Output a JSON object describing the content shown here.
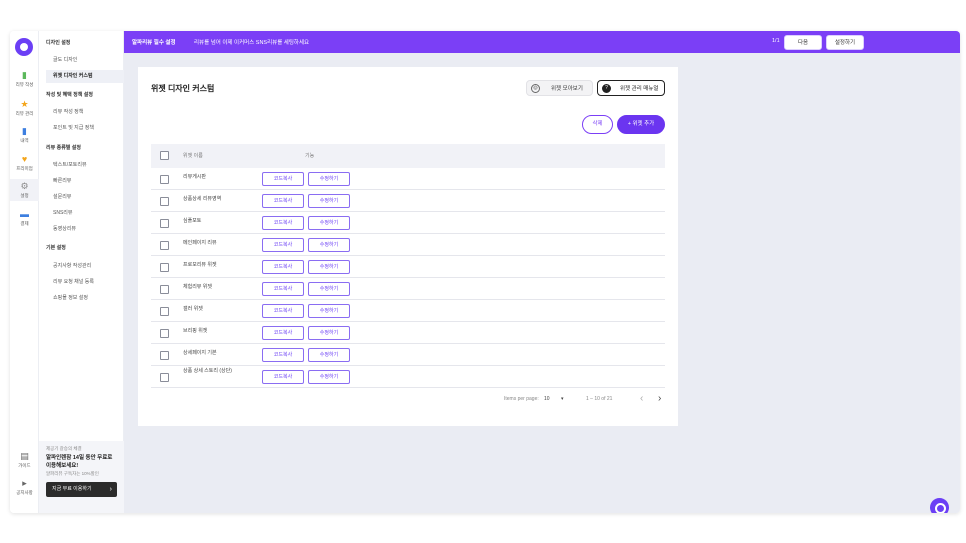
{
  "topbar": {
    "title": "알파리뷰 필수 설정",
    "notice": "리뷰를 넘어 이제 이커머스 SNS리뷰를 세팅하세요",
    "counter": "1/1",
    "next_label": "다음",
    "go_label": "설정하기"
  },
  "rail": {
    "items": [
      {
        "label": "리뷰 작성",
        "icon": "review-write-icon",
        "glyph": "▮",
        "color": "#5bb85b"
      },
      {
        "label": "리뷰 관리",
        "icon": "star-icon",
        "glyph": "★",
        "color": "#f3a51c"
      },
      {
        "label": "내역",
        "icon": "bar-chart-icon",
        "glyph": "▮",
        "color": "#3d7fe0"
      },
      {
        "label": "프리미엄",
        "icon": "heart-icon",
        "glyph": "♥",
        "color": "#f3a51c"
      },
      {
        "label": "설정",
        "icon": "gear-icon",
        "glyph": "⚙",
        "color": "#888888"
      },
      {
        "label": "결제",
        "icon": "card-icon",
        "glyph": "▬",
        "color": "#3d7fe0"
      }
    ],
    "bottom": [
      {
        "label": "가이드",
        "icon": "book-icon",
        "glyph": "▤",
        "color": "#666666"
      },
      {
        "label": "공지사항",
        "icon": "megaphone-icon",
        "glyph": "▸",
        "color": "#666666"
      }
    ]
  },
  "sidebar": {
    "sections": [
      {
        "title": "디자인 설정",
        "items": [
          "글도 디자인",
          "위젯 디자인 커스텀"
        ]
      },
      {
        "title": "작성 및 혜택 정책 설정",
        "items": [
          "리뷰 작성 정책",
          "포인트 및 지급 정책"
        ]
      },
      {
        "title": "리뷰 종류별 설정",
        "items": [
          "텍스트/포토리뷰",
          "빠른리뷰",
          "설문리뷰",
          "SNS리뷰",
          "동영상리뷰"
        ]
      },
      {
        "title": "기본 설정",
        "items": [
          "공지사항 작성관리",
          "리뷰 요청 채널 등록",
          "쇼핑몰 정보 설정"
        ]
      }
    ],
    "promo": {
      "line1": "제공기 갈승의 체결",
      "line2": "알파인렌잠 14일 동안 무료로 이용해보세요!",
      "line3": "알파리뷰 구독자는 10%할인",
      "cta": "지금 무료 이용하기"
    }
  },
  "card": {
    "title": "위젯 디자인 커스텀",
    "preview_label": "위젯 모아보기",
    "manual_label": "위젯 관리 매뉴얼",
    "delete_label": "삭제",
    "add_label": "+ 위젯 추가",
    "table": {
      "headers": [
        "위젯 이름",
        "기능"
      ],
      "rows": [
        {
          "name": "리뷰게시판"
        },
        {
          "name": "상품상세 리뷰영역"
        },
        {
          "name": "심플포토"
        },
        {
          "name": "메인페이지 리뷰"
        },
        {
          "name": "프로모리뷰 위젯"
        },
        {
          "name": "체험리뷰 위젯"
        },
        {
          "name": "갤러 위젯"
        },
        {
          "name": "브리핑 위젯"
        },
        {
          "name": "상세페이지 기본"
        },
        {
          "name": "상품 상세 스토리 (상단)"
        }
      ],
      "copy_label": "코드복사",
      "edit_label": "수정하기"
    },
    "pager": {
      "items_label": "Items per page:",
      "per_page": "10",
      "range": "1 – 10 of 21"
    }
  }
}
